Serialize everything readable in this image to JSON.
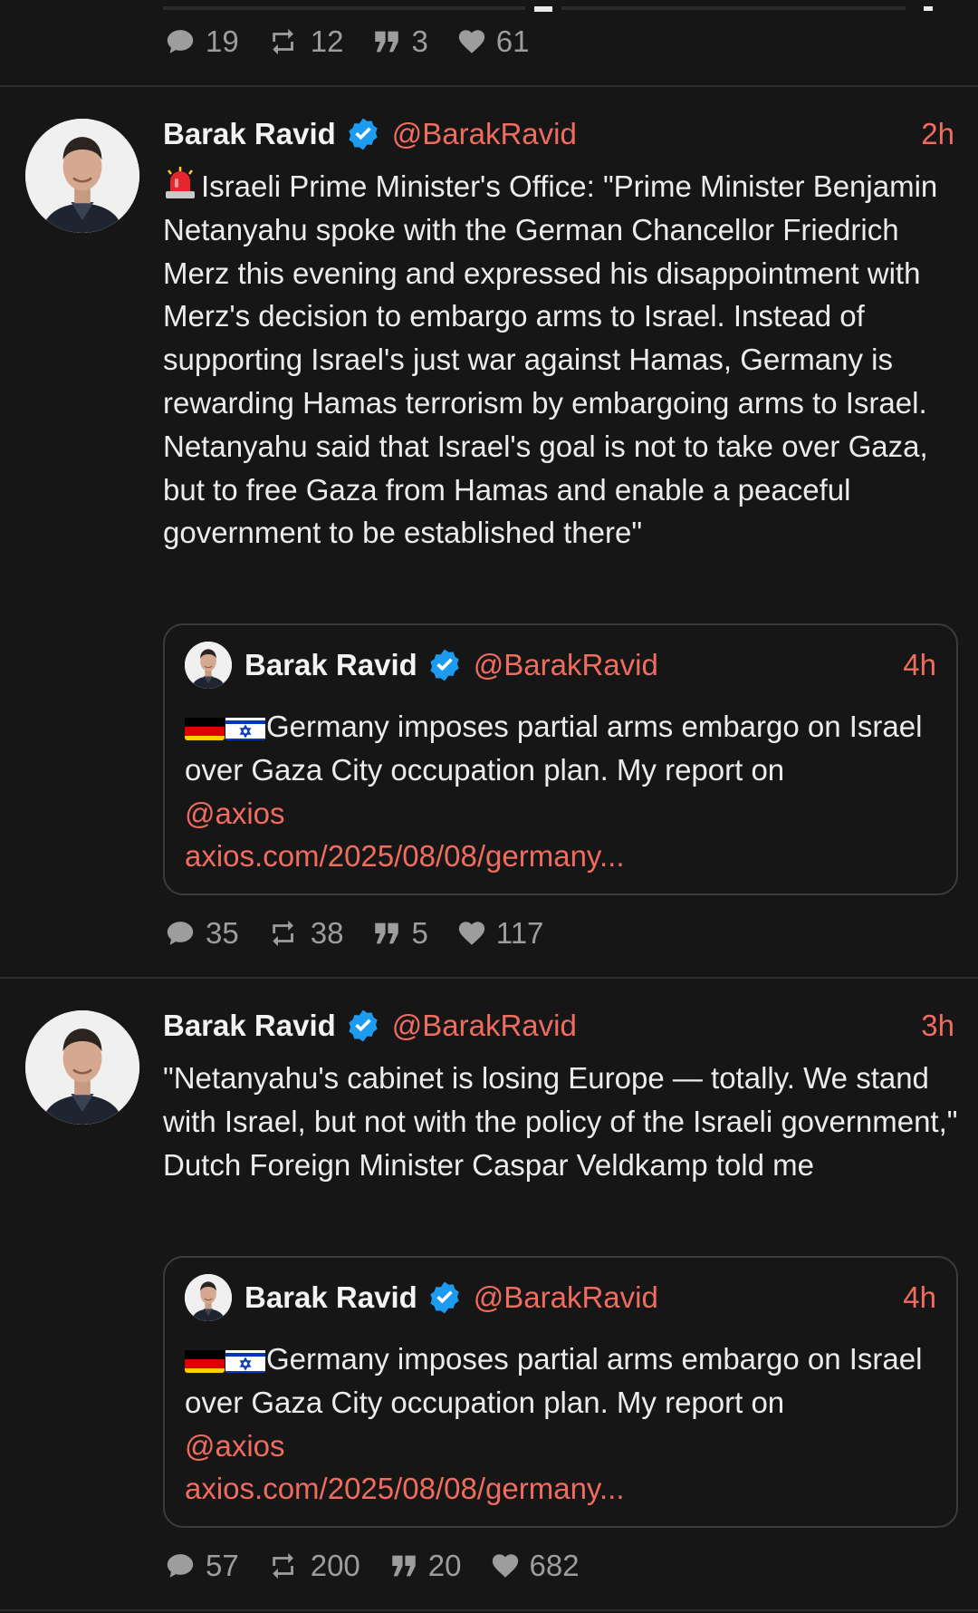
{
  "colors": {
    "background": "#161616",
    "accent": "#ef6c5e",
    "muted": "#9d9d9d",
    "verified": "#1d9bf0"
  },
  "top_post": {
    "replies": "19",
    "reposts": "12",
    "quotes": "3",
    "likes": "61"
  },
  "posts": [
    {
      "author": "Barak Ravid",
      "handle": "@BarakRavid",
      "time": "2h",
      "lead_icon": "rotating-light-emoji",
      "text": "Israeli Prime Minister's Office: \"Prime Minister Benjamin Netanyahu spoke with the German Chancellor Friedrich Merz this evening and expressed his disappointment with Merz's decision to embargo arms to Israel. Instead of supporting Israel's just war against Hamas, Germany is rewarding Hamas terrorism by embargoing arms to Israel. Netanyahu said that Israel's goal is not to take over Gaza, but to free Gaza from Hamas and enable a peaceful government to be established there\"",
      "quote": {
        "author": "Barak Ravid",
        "handle": "@BarakRavid",
        "time": "4h",
        "flags": [
          "germany-flag",
          "israel-flag"
        ],
        "text": "Germany imposes partial arms embargo on Israel over Gaza City occupation plan. My report on",
        "mention": "@axios",
        "link": "axios.com/2025/08/08/germany..."
      },
      "stats": {
        "replies": "35",
        "reposts": "38",
        "quotes": "5",
        "likes": "117"
      }
    },
    {
      "author": "Barak Ravid",
      "handle": "@BarakRavid",
      "time": "3h",
      "text": "\"Netanyahu's cabinet is losing Europe — totally. We stand with Israel, but not with the policy of the Israeli government,\" Dutch Foreign Minister Caspar Veldkamp told me",
      "quote": {
        "author": "Barak Ravid",
        "handle": "@BarakRavid",
        "time": "4h",
        "flags": [
          "germany-flag",
          "israel-flag"
        ],
        "text": "Germany imposes partial arms embargo on Israel over Gaza City occupation plan. My report on",
        "mention": "@axios",
        "link": "axios.com/2025/08/08/germany..."
      },
      "stats": {
        "replies": "57",
        "reposts": "200",
        "quotes": "20",
        "likes": "682"
      }
    }
  ]
}
